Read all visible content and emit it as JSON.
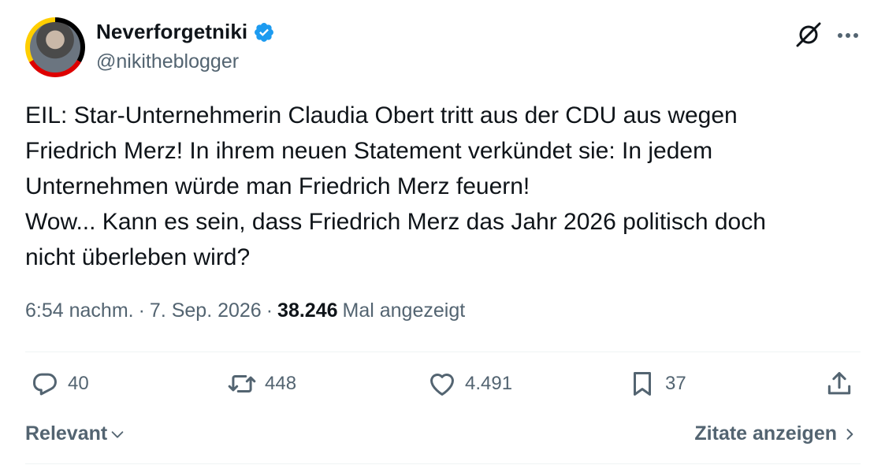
{
  "author": {
    "display_name": "Neverforgetniki",
    "handle": "@nikitheblogger",
    "verified": true,
    "verified_color": "#1d9bf0"
  },
  "icons": {
    "grok": "grok-icon",
    "more": "more-icon",
    "reply": "reply-icon",
    "retweet": "retweet-icon",
    "like": "heart-icon",
    "bookmark": "bookmark-icon",
    "share": "share-icon",
    "chevron_down": "chevron-down-icon",
    "chevron_right": "chevron-right-icon"
  },
  "tweet": {
    "text": "EIL: Star-Unternehmerin Claudia Obert tritt aus der CDU aus wegen\nFriedrich Merz! In ihrem neuen Statement verkündet sie: In jedem\nUnternehmen würde man Friedrich Merz feuern!\nWow... Kann es sein, dass Friedrich Merz das Jahr 2026 politisch doch\nnicht überleben wird?",
    "time": "6:54 nachm.",
    "date": "7. Sep. 2026",
    "separator": "·",
    "views_count": "38.246",
    "views_label": "Mal angezeigt"
  },
  "actions": {
    "replies": "40",
    "reposts": "448",
    "likes": "4.491",
    "bookmarks": "37"
  },
  "footer": {
    "sort_label": "Relevant",
    "quotes_label": "Zitate anzeigen"
  },
  "colors": {
    "text_primary": "#0f1419",
    "text_secondary": "#536471",
    "divider": "#eff3f4"
  }
}
